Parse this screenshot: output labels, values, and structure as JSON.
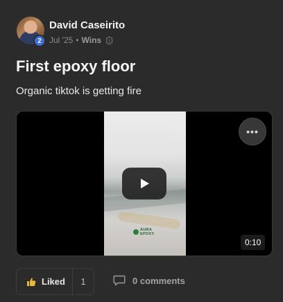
{
  "post": {
    "author": {
      "name": "David Caseirito",
      "level": "2",
      "avatar": "avatar-photo"
    },
    "meta": {
      "date": "Jul '25",
      "separator": "•",
      "category": "Wins",
      "category_icon": "coin-icon"
    },
    "title": "First epoxy floor",
    "body": "Organic tiktok is getting fire",
    "video": {
      "duration": "0:10",
      "more_label": "•••",
      "play_icon": "play-icon",
      "brand_line1": "AURA",
      "brand_line2": "EPOXY"
    },
    "actions": {
      "like_label": "Liked",
      "like_count": "1",
      "like_icon": "thumbs-up-icon",
      "comments_label": "0 comments",
      "comments_icon": "comment-icon"
    }
  },
  "colors": {
    "background": "#2b2b2b",
    "level_badge": "#3f6dd8",
    "liked_accent": "#e8b93a"
  }
}
